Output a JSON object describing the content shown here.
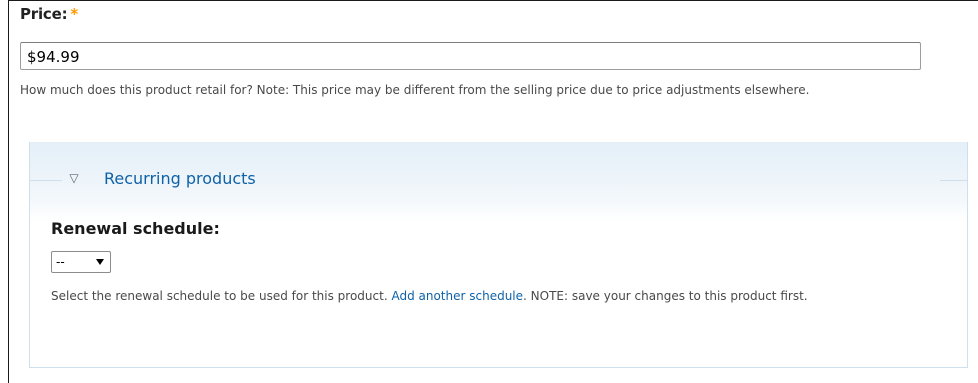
{
  "price_field": {
    "label": "Price:",
    "required_marker": "*",
    "value": "$94.99",
    "description": "How much does this product retail for? Note: This price may be different from the selling price due to price adjustments elsewhere."
  },
  "recurring_fieldset": {
    "toggle_icon": "▽",
    "legend": "Recurring products",
    "renewal": {
      "label": "Renewal schedule:",
      "selected": "--",
      "description_before": "Select the renewal schedule to be used for this product. ",
      "link_text": "Add another schedule",
      "description_after": ". NOTE: save your changes to this product first."
    }
  },
  "colors": {
    "link": "#0f62a8",
    "required": "#ff9900",
    "fieldset_border": "#cfe0ec"
  }
}
